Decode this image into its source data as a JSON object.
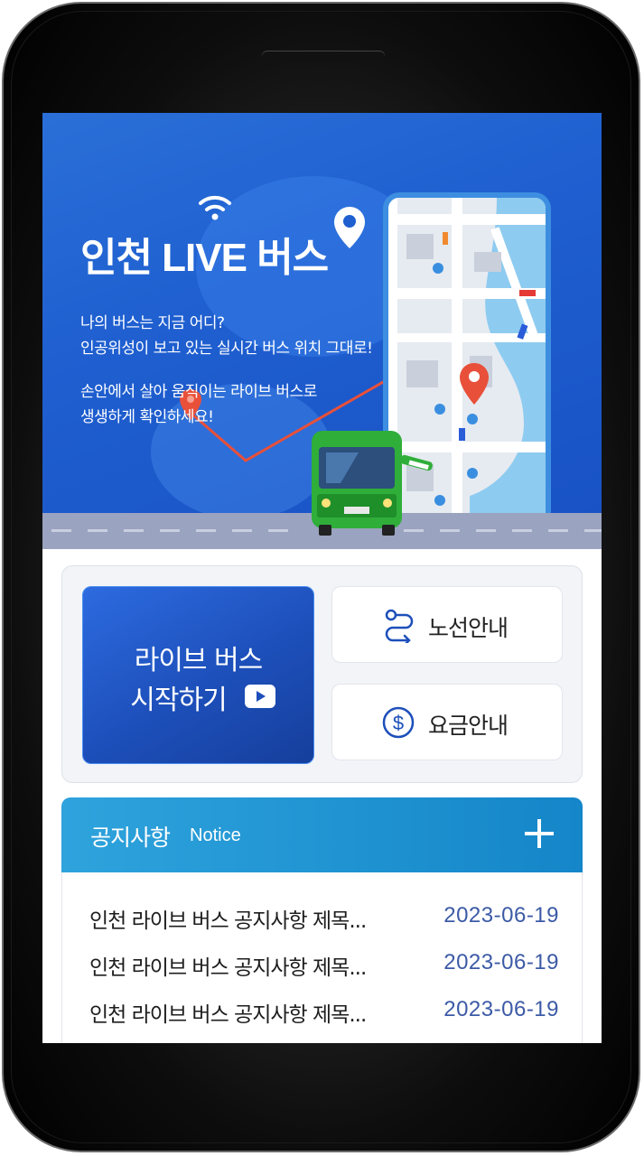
{
  "banner": {
    "title": "인천 LIVE 버스",
    "line1": "나의 버스는 지금 어디?",
    "line2": "인공위성이 보고 있는 실시간 버스 위치 그대로!",
    "line3": "손안에서 살아 움직이는 라이브 버스로",
    "line4": "생생하게 확인하세요!"
  },
  "actions": {
    "live_line1": "라이브 버스",
    "live_line2": "시작하기",
    "route_label": "노선안내",
    "fare_label": "요금안내"
  },
  "notice": {
    "title": "공지사항",
    "subtitle": "Notice",
    "items": [
      {
        "title": "인천 라이브 버스 공지사항 제목...",
        "date": "2023-06-19"
      },
      {
        "title": "인천 라이브 버스 공지사항 제목...",
        "date": "2023-06-19"
      },
      {
        "title": "인천 라이브 버스 공지사항 제목...",
        "date": "2023-06-19"
      }
    ]
  },
  "colors": {
    "banner_blue": "#1f5fd0",
    "live_button": "#1d4fba",
    "notice_header": "#1486c9",
    "date_text": "#3c5aa6",
    "bus_green": "#2fae3a",
    "route_line": "#e8503a"
  }
}
